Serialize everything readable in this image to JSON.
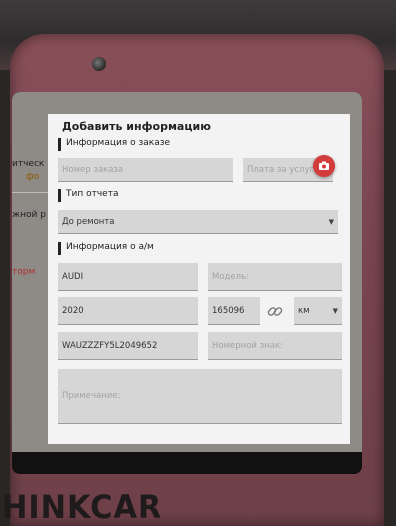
{
  "device": {
    "brand": "HINKCAR"
  },
  "background_app": {
    "items": [
      "итческ",
      "фо",
      "жной р",
      "торм"
    ]
  },
  "dialog": {
    "title": "Добавить информацию",
    "sections": {
      "order": "Информация о заказе",
      "report_type": "Тип отчета",
      "vehicle": "Информация о а/м"
    },
    "order_number_placeholder": "Номер заказа",
    "service_fee_placeholder": "Плата за услуги",
    "report_type_value": "До ремонта",
    "make": "AUDI",
    "model_placeholder": "Модель:",
    "year": "2020",
    "mileage": "165096",
    "mileage_unit": "км",
    "vin": "WAUZZZFY5L2049652",
    "plate_placeholder": "Номерной знак:",
    "note_placeholder": "Примечание:"
  },
  "colors": {
    "accent": "#d23c3c",
    "device": "#7a4650"
  }
}
